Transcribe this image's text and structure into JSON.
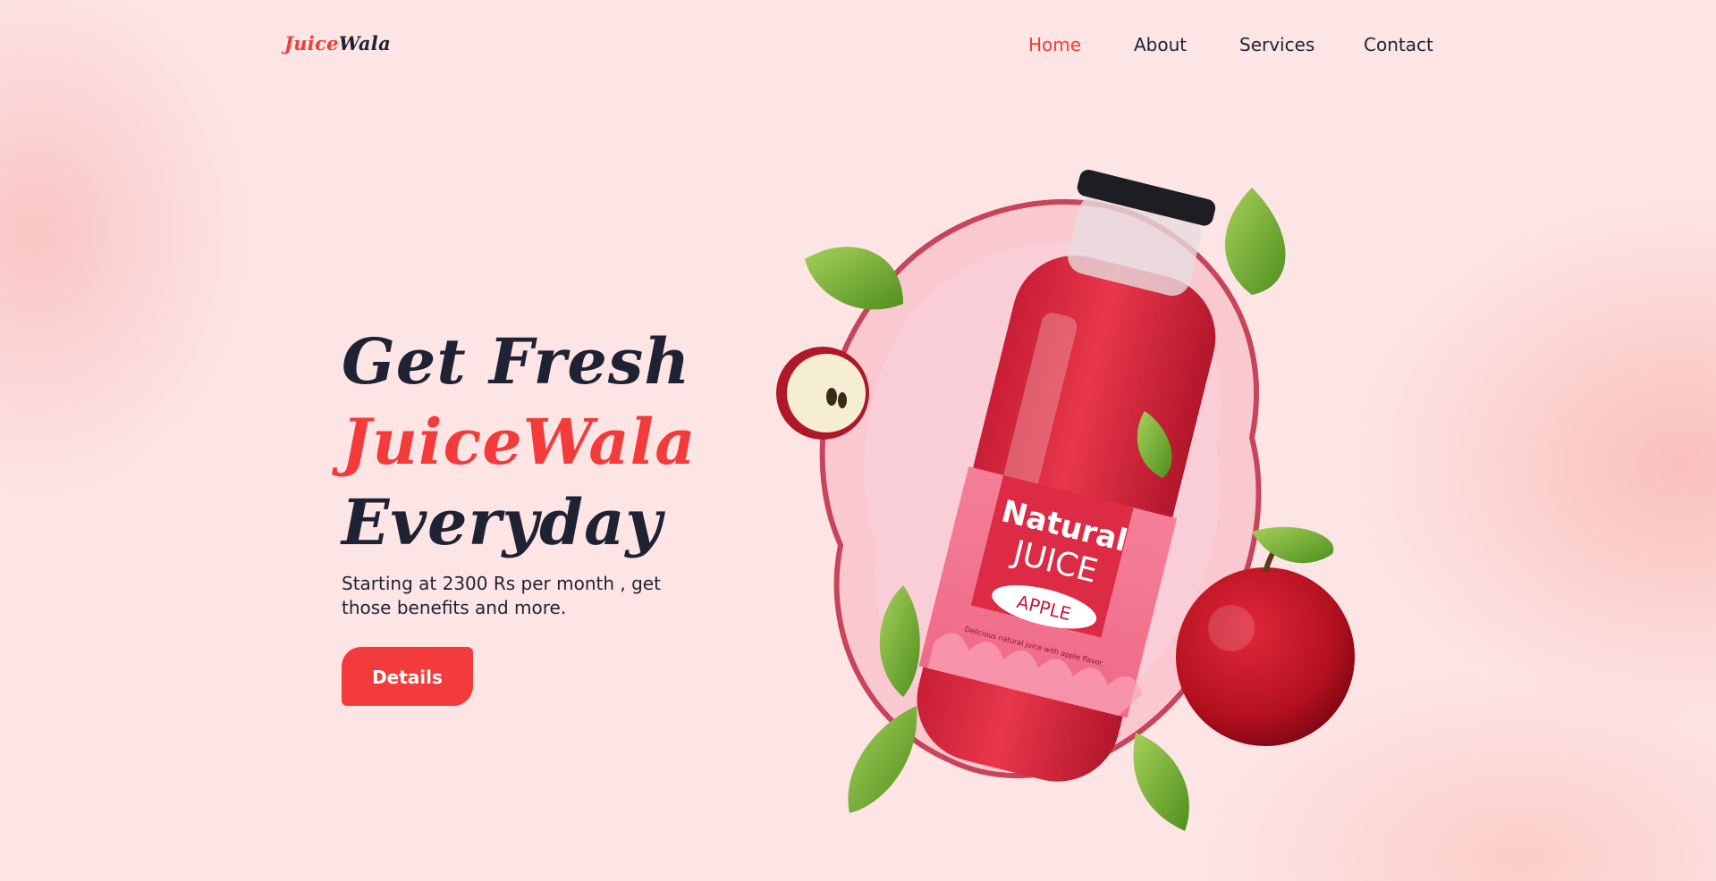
{
  "brand": {
    "logo_part1": "Juice",
    "logo_part2": "Wala",
    "accent_color": "#f43b3b",
    "dark_color": "#1f2233",
    "background_color": "#fde5e5"
  },
  "nav": {
    "items": [
      {
        "label": "Home",
        "active": true
      },
      {
        "label": "About",
        "active": false
      },
      {
        "label": "Services",
        "active": false
      },
      {
        "label": "Contact",
        "active": false
      }
    ]
  },
  "hero": {
    "line1": "Get Fresh",
    "line2": "JuiceWala",
    "line3": "Everyday",
    "subtitle": "Starting at 2300 Rs per month , get those benefits and more.",
    "button_label": "Details"
  },
  "product": {
    "label_top": "Natural",
    "label_main": "JUICE",
    "label_flavor": "APPLE",
    "label_tagline": "Delicious natural juice with apple flavor."
  }
}
